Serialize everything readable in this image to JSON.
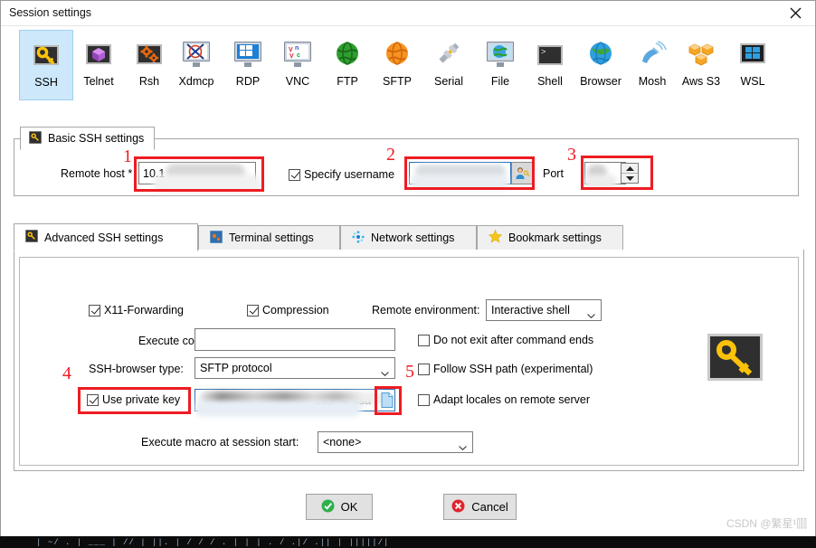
{
  "window": {
    "title": "Session settings",
    "close_label": "close-icon"
  },
  "protocols": [
    {
      "label": "SSH",
      "icon": "key-icon",
      "selected": true
    },
    {
      "label": "Telnet",
      "icon": "cube-icon",
      "selected": false
    },
    {
      "label": "Rsh",
      "icon": "gears-icon",
      "selected": false
    },
    {
      "label": "Xdmcp",
      "icon": "x-monitor-icon",
      "selected": false
    },
    {
      "label": "RDP",
      "icon": "windows-monitor-icon",
      "selected": false
    },
    {
      "label": "VNC",
      "icon": "vnc-monitor-icon",
      "selected": false
    },
    {
      "label": "FTP",
      "icon": "green-globe-icon",
      "selected": false
    },
    {
      "label": "SFTP",
      "icon": "orange-globe-icon",
      "selected": false
    },
    {
      "label": "Serial",
      "icon": "plug-icon",
      "selected": false
    },
    {
      "label": "File",
      "icon": "file-monitor-icon",
      "selected": false
    },
    {
      "label": "Shell",
      "icon": "console-icon",
      "selected": false
    },
    {
      "label": "Browser",
      "icon": "blue-globe-icon",
      "selected": false
    },
    {
      "label": "Mosh",
      "icon": "satellite-icon",
      "selected": false
    },
    {
      "label": "Aws S3",
      "icon": "aws-cubes-icon",
      "selected": false
    },
    {
      "label": "WSL",
      "icon": "windows-icon",
      "selected": false
    }
  ],
  "basic": {
    "group_label": "Basic SSH settings",
    "group_icon": "key-icon",
    "remote_host_label": "Remote host *",
    "remote_host_value": "10.1",
    "specify_username_label": "Specify username",
    "specify_username_checked": true,
    "username_value": "",
    "username_button_icon": "user-key-icon",
    "port_label": "Port",
    "port_value": ""
  },
  "tabs": [
    {
      "label": "Advanced SSH settings",
      "icon": "key-icon",
      "active": true
    },
    {
      "label": "Terminal settings",
      "icon": "terminal-icon",
      "active": false
    },
    {
      "label": "Network settings",
      "icon": "network-icon",
      "active": false
    },
    {
      "label": "Bookmark settings",
      "icon": "star-icon",
      "active": false
    }
  ],
  "advanced": {
    "x11_label": "X11-Forwarding",
    "x11_checked": true,
    "compression_label": "Compression",
    "compression_checked": true,
    "remote_env_label": "Remote environment:",
    "remote_env_value": "Interactive shell",
    "execute_command_label": "Execute command:",
    "execute_command_value": "",
    "do_not_exit_label": "Do not exit after command ends",
    "do_not_exit_checked": false,
    "ssh_browser_label": "SSH-browser type:",
    "ssh_browser_value": "SFTP protocol",
    "follow_ssh_path_label": "Follow SSH path (experimental)",
    "follow_ssh_path_checked": false,
    "use_private_key_label": "Use private key",
    "use_private_key_checked": true,
    "private_key_value": "125_id_rsa",
    "private_key_browse_icon": "file-browse-icon",
    "adapt_locales_label": "Adapt locales on remote server",
    "adapt_locales_checked": false,
    "execute_macro_label": "Execute macro at session start:",
    "execute_macro_value": "<none>",
    "side_icon": "key-icon"
  },
  "buttons": {
    "ok_label": "OK",
    "ok_icon": "green-check-icon",
    "cancel_label": "Cancel",
    "cancel_icon": "red-x-icon"
  },
  "annotations": [
    {
      "number": "1",
      "target": "remote-host-field"
    },
    {
      "number": "2",
      "target": "username-field"
    },
    {
      "number": "3",
      "target": "port-field"
    },
    {
      "number": "4",
      "target": "use-private-key-checkbox"
    },
    {
      "number": "5",
      "target": "private-key-browse-button"
    }
  ],
  "watermark": "CSDN @繁星¹⫿⫿⫿",
  "colors": {
    "accent_selected": "#cde8fb",
    "annotation_red": "#ee1c23",
    "key_yellow": "#fcc209",
    "ok_green": "#2eb04b",
    "cancel_red": "#e0242c"
  }
}
